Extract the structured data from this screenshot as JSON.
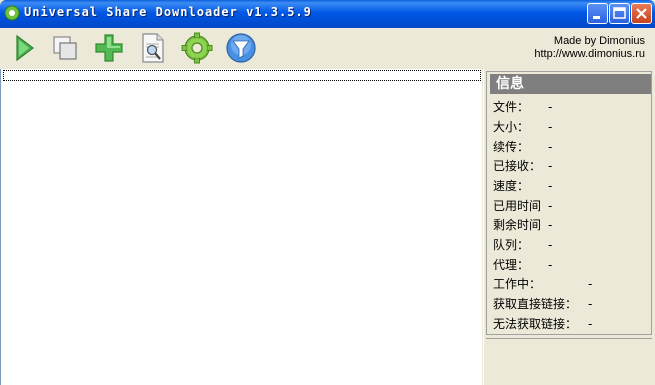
{
  "window": {
    "title": "Universal Share Downloader v1.3.5.9"
  },
  "toolbar": {
    "buttons": [
      {
        "name": "start",
        "icon": "play-icon"
      },
      {
        "name": "copy",
        "icon": "copy-icon"
      },
      {
        "name": "add",
        "icon": "plus-icon"
      },
      {
        "name": "inspect",
        "icon": "document-magnifier-icon"
      },
      {
        "name": "settings",
        "icon": "gear-icon"
      },
      {
        "name": "filter",
        "icon": "funnel-icon"
      }
    ],
    "credit_line1": "Made by Dimonius",
    "credit_line2": "http://www.dimonius.ru"
  },
  "info": {
    "header": "信息",
    "rows": [
      {
        "label": "文件：",
        "value": "-"
      },
      {
        "label": "大小：",
        "value": "-"
      },
      {
        "label": "续传：",
        "value": "-"
      },
      {
        "label": "已接收：",
        "value": "-"
      },
      {
        "label": "速度：",
        "value": "-"
      },
      {
        "label": "已用时间",
        "value": "-"
      },
      {
        "label": "剩余时间",
        "value": "-"
      },
      {
        "label": "队列：",
        "value": "-"
      },
      {
        "label": "代理：",
        "value": "-"
      },
      {
        "label": "工作中：",
        "value": "-"
      },
      {
        "label": "获取直接链接：",
        "value": "-"
      },
      {
        "label": "无法获取链接：",
        "value": "-"
      }
    ]
  },
  "colors": {
    "titlebar": "#0058E6",
    "window_bg": "#ECE9D8",
    "info_header_bg": "#7F7F7F"
  }
}
